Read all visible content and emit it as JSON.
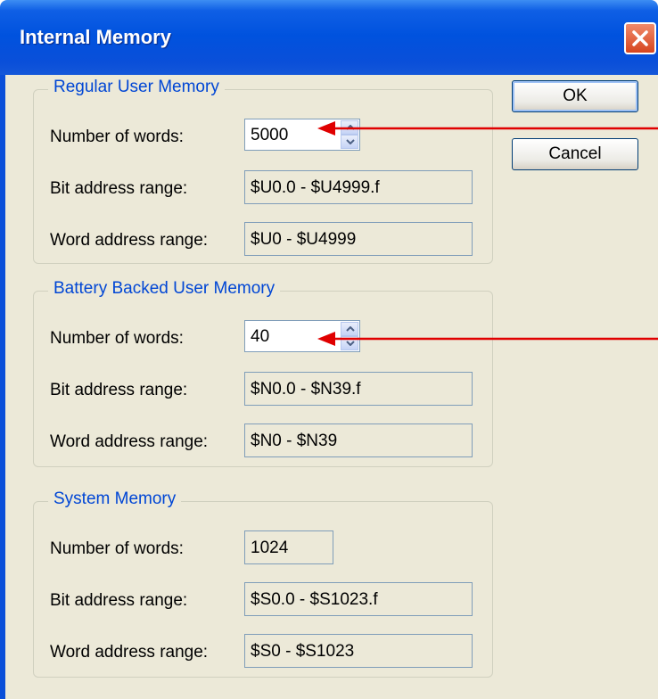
{
  "window": {
    "title": "Internal Memory"
  },
  "buttons": {
    "ok": "OK",
    "cancel": "Cancel"
  },
  "regular": {
    "legend": "Regular User Memory",
    "words_label": "Number of words:",
    "words_value": "5000",
    "bit_label": "Bit address range:",
    "bit_value": "$U0.0 - $U4999.f",
    "word_label": "Word address range:",
    "word_value": "$U0 - $U4999"
  },
  "battery": {
    "legend": "Battery Backed User Memory",
    "words_label": "Number of words:",
    "words_value": "40",
    "bit_label": "Bit address range:",
    "bit_value": "$N0.0 - $N39.f",
    "word_label": "Word address range:",
    "word_value": "$N0 - $N39"
  },
  "system": {
    "legend": "System Memory",
    "words_label": "Number of words:",
    "words_value": "1024",
    "bit_label": "Bit address range:",
    "bit_value": "$S0.0 - $S1023.f",
    "word_label": "Word address range:",
    "word_value": "$S0 - $S1023"
  },
  "colors": {
    "title_bar": "#0052de",
    "dialog_bg": "#ece9d8",
    "group_legend": "#0046d5",
    "annotation_arrow": "#e00000"
  },
  "icons": {
    "close": "close-icon",
    "spin_up": "chevron-up-icon",
    "spin_down": "chevron-down-icon"
  }
}
